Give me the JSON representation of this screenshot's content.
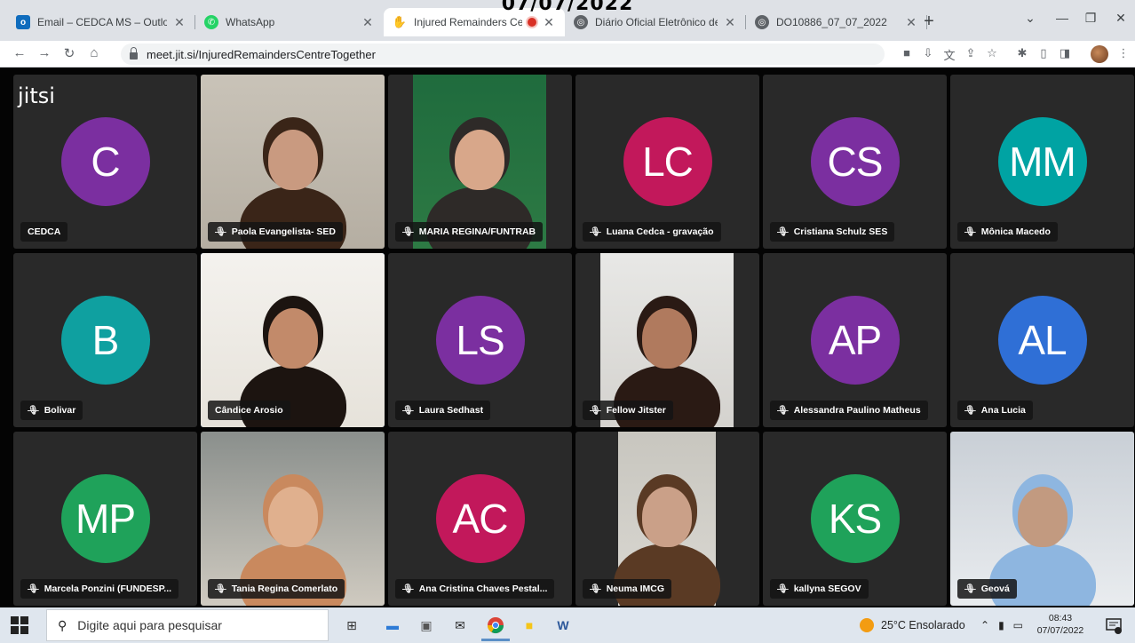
{
  "date_overlay": "07/07/2022",
  "browser": {
    "tabs": [
      {
        "title": "Email – CEDCA MS – Outlook",
        "icon": "outlook-icon",
        "color": "#0f6cbd"
      },
      {
        "title": "WhatsApp",
        "icon": "whatsapp-icon",
        "color": "#25d366"
      },
      {
        "title": "Injured Remainders Cent",
        "icon": "jitsi-icon",
        "color": "#333333",
        "active": true
      },
      {
        "title": "Diário Oficial Eletrônico de M",
        "icon": "globe-icon",
        "color": "#5f6368"
      },
      {
        "title": "DO10886_07_07_2022",
        "icon": "globe-icon",
        "color": "#5f6368"
      }
    ],
    "url": "meet.jit.si/InjuredRemaindersCentreTogether"
  },
  "meeting": {
    "logo": "jitsi",
    "participants": [
      {
        "name": "CEDCA",
        "initials": "C",
        "color": "#7b2fa0",
        "muted": false,
        "video": false
      },
      {
        "name": "Paola Evangelista- SED",
        "muted": true,
        "video": true
      },
      {
        "name": "MARIA REGINA/FUNTRAB",
        "muted": true,
        "video": true
      },
      {
        "name": "Luana Cedca - gravação",
        "initials": "LC",
        "color": "#c2185b",
        "muted": true,
        "video": false
      },
      {
        "name": "Cristiana Schulz SES",
        "initials": "CS",
        "color": "#7b2fa0",
        "muted": true,
        "video": false
      },
      {
        "name": "Mônica Macedo",
        "initials": "MM",
        "color": "#00a3a3",
        "muted": true,
        "video": false
      },
      {
        "name": "Bolivar",
        "initials": "B",
        "color": "#0fa0a0",
        "muted": true,
        "video": false
      },
      {
        "name": "Cândice Arosio",
        "muted": false,
        "video": true,
        "dominant": true
      },
      {
        "name": "Laura Sedhast",
        "initials": "LS",
        "color": "#7b2fa0",
        "muted": true,
        "video": false
      },
      {
        "name": "Fellow Jitster",
        "muted": true,
        "video": true
      },
      {
        "name": "Alessandra Paulino Matheus",
        "initials": "AP",
        "color": "#7b2fa0",
        "muted": true,
        "video": false
      },
      {
        "name": "Ana Lucia",
        "initials": "AL",
        "color": "#2f6fd6",
        "muted": true,
        "video": false
      },
      {
        "name": "Marcela Ponzini (FUNDESP...",
        "initials": "MP",
        "color": "#1fa25a",
        "muted": true,
        "video": false
      },
      {
        "name": "Tania Regina Comerlato",
        "muted": true,
        "video": true
      },
      {
        "name": "Ana Cristina Chaves Pestal...",
        "initials": "AC",
        "color": "#c2185b",
        "muted": true,
        "video": false
      },
      {
        "name": "Neuma IMCG",
        "muted": true,
        "video": true
      },
      {
        "name": "kallyna SEGOV",
        "initials": "KS",
        "color": "#1fa25a",
        "muted": true,
        "video": false
      },
      {
        "name": "Geová",
        "muted": true,
        "video": true
      }
    ]
  },
  "taskbar": {
    "search_placeholder": "Digite aqui para pesquisar",
    "weather": "25°C  Ensolarado",
    "time": "08:43",
    "date": "07/07/2022"
  }
}
